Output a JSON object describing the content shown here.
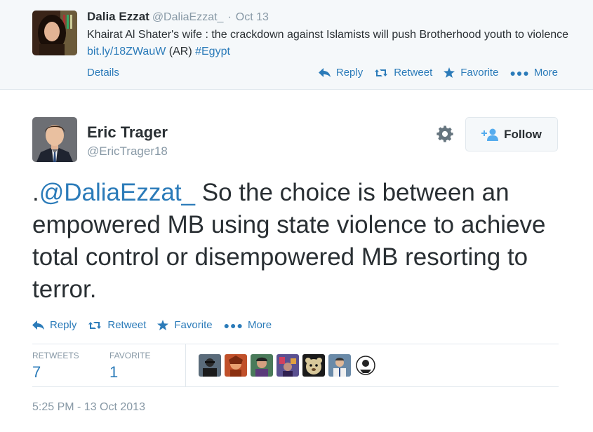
{
  "parent_tweet": {
    "name": "Dalia Ezzat",
    "handle": "@DaliaEzzat_",
    "separator": "·",
    "time": "Oct 13",
    "text_before_link": "Khairat Al Shater's wife : the crackdown against Islamists will push Brotherhood youth to violence ",
    "link": "bit.ly/18ZWauW",
    "text_after_link": " (AR) ",
    "hashtag": "#Egypt",
    "details_label": "Details",
    "actions": {
      "reply": "Reply",
      "retweet": "Retweet",
      "favorite": "Favorite",
      "more": "More"
    }
  },
  "main_tweet": {
    "name": "Eric Trager",
    "handle": "@EricTrager18",
    "follow_label": "Follow",
    "text_prefix": ".",
    "mention": "@DaliaEzzat_",
    "text_body": " So the choice is between an empowered MB using state violence to achieve total control or disempowered MB resorting to terror.",
    "actions": {
      "reply": "Reply",
      "retweet": "Retweet",
      "favorite": "Favorite",
      "more": "More"
    },
    "stats": {
      "retweets_label": "RETWEETS",
      "retweets_value": "7",
      "favorites_label": "FAVORITE",
      "favorites_value": "1"
    },
    "timestamp": "5:25 PM - 13 Oct 2013"
  },
  "colors": {
    "link": "#2b7bb9",
    "muted": "#8899a6",
    "text": "#292f33",
    "parent_bg": "#f5f8fa",
    "border": "#e1e8ed"
  },
  "icons": {
    "reply": "reply-arrow-icon",
    "retweet": "retweet-icon",
    "favorite": "star-icon",
    "more": "dots-icon",
    "settings": "gear-icon",
    "follow": "add-user-icon"
  }
}
